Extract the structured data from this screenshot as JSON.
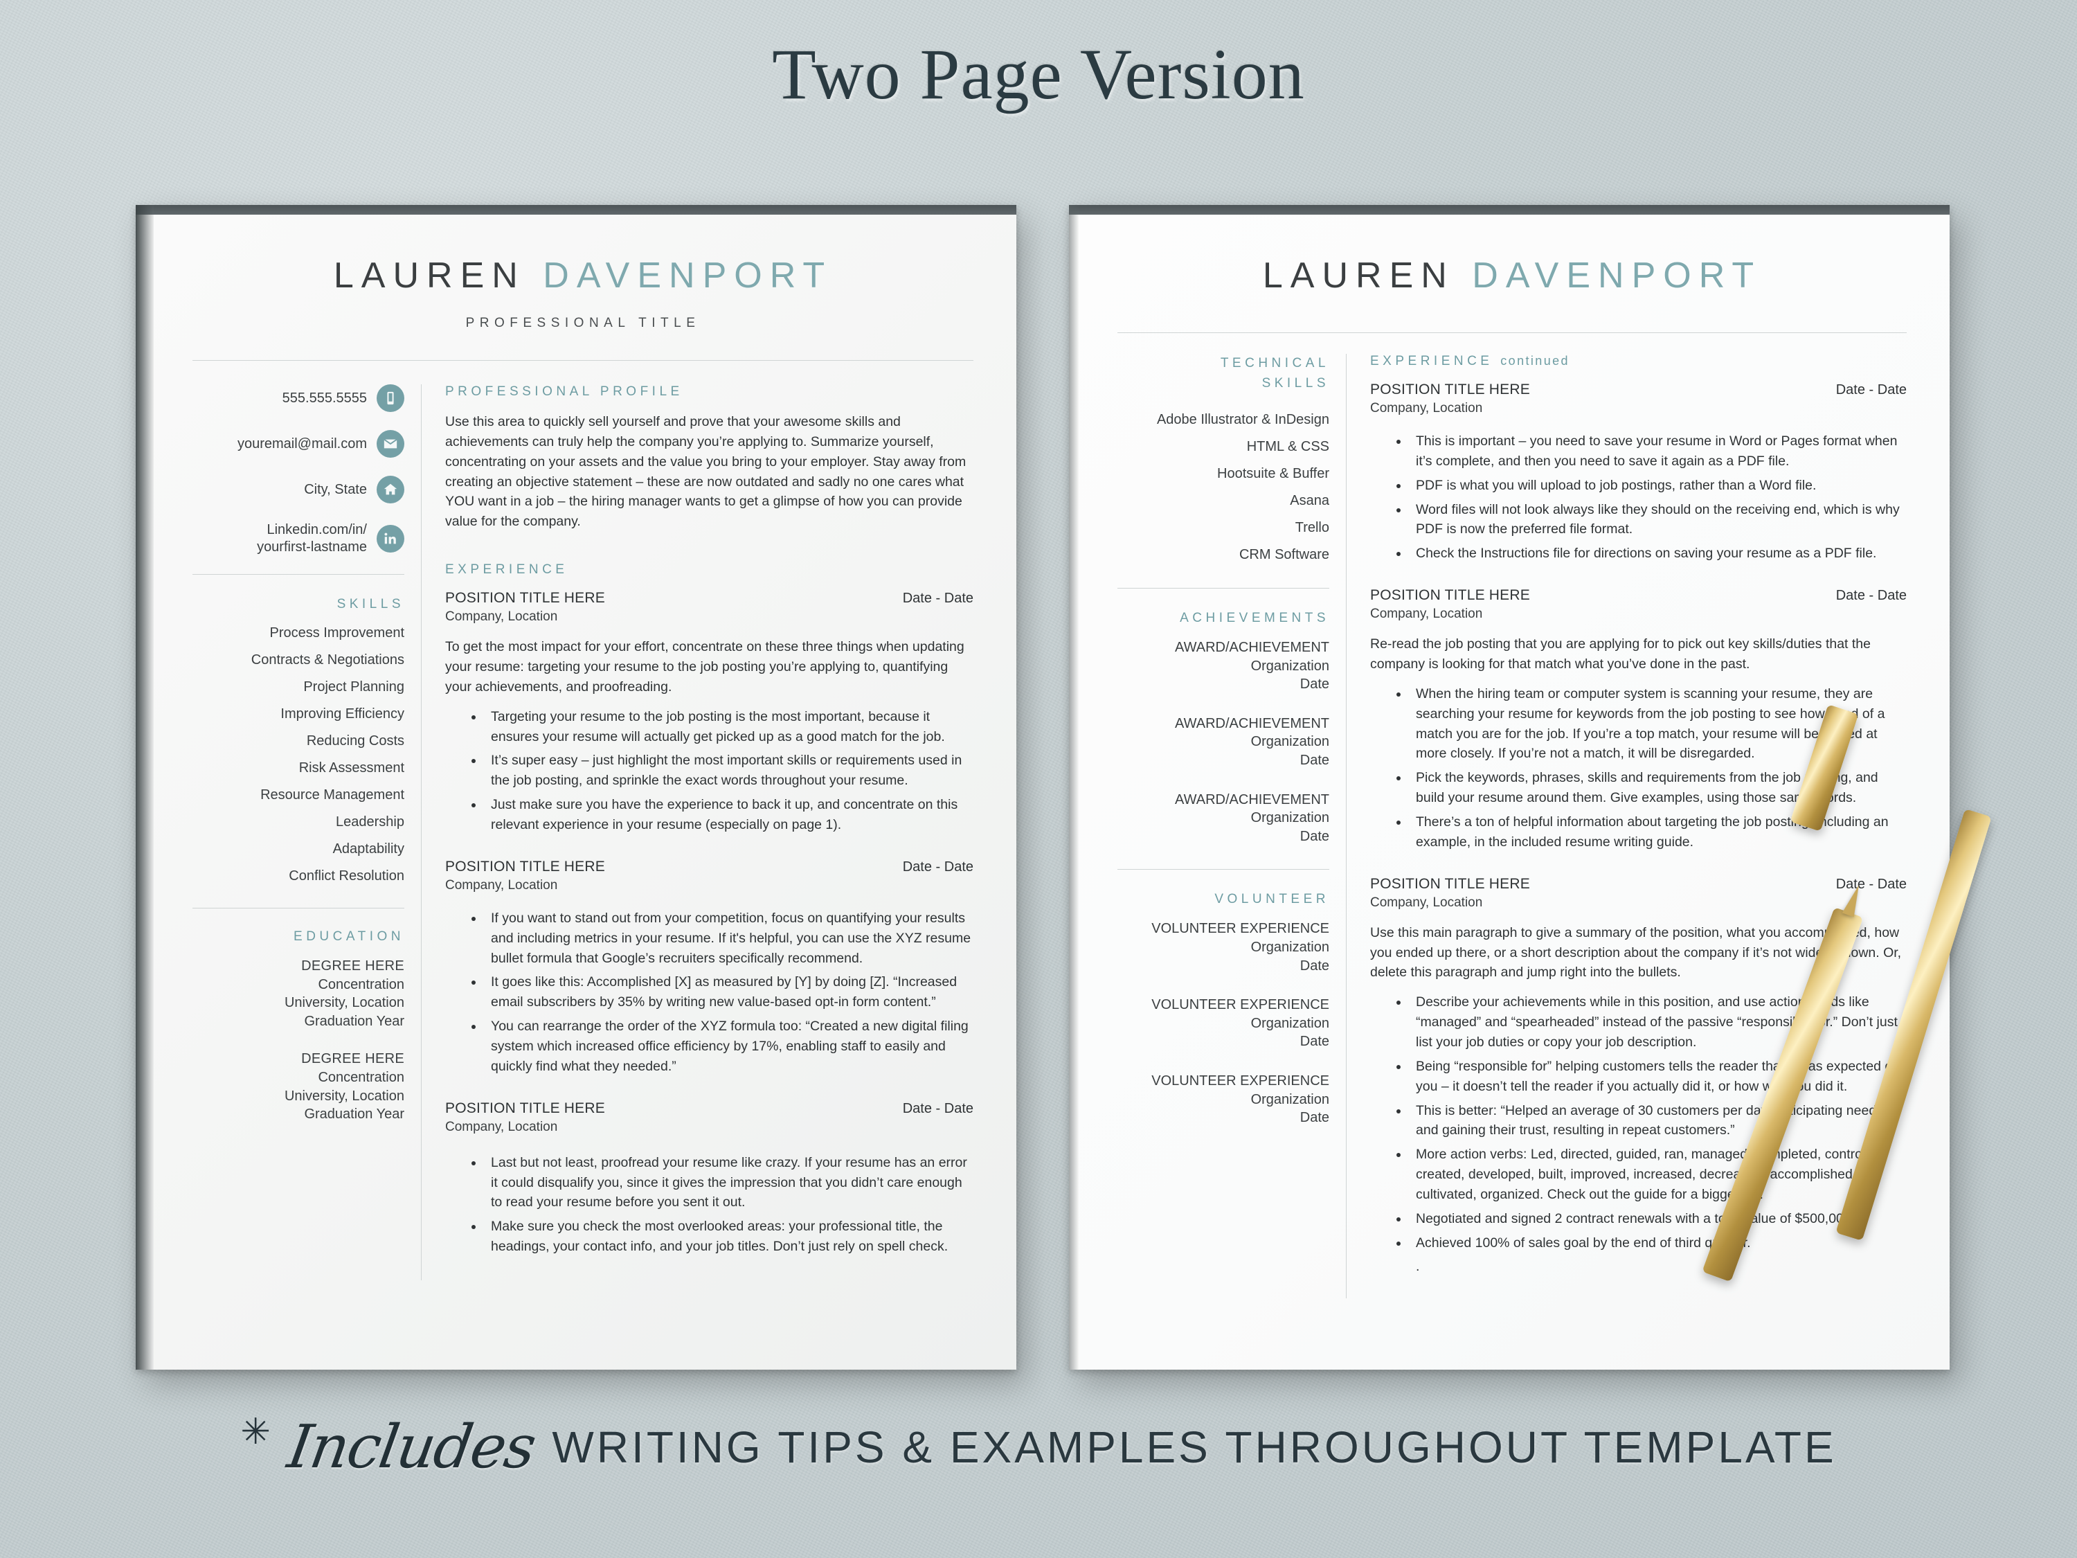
{
  "headline": "Two Page Version",
  "footer": {
    "star": "✳",
    "script_word": "Includes",
    "tagline": "WRITING TIPS & EXAMPLES THROUGHOUT TEMPLATE"
  },
  "colors": {
    "accent_teal": "#6d9ca2",
    "name_last": "#7fa9ae",
    "icon_circle": "#74a0a6",
    "body_text": "#2f3335",
    "background": "#c6d0d2"
  },
  "page1": {
    "name_first": "LAUREN",
    "name_last": "DAVENPORT",
    "professional_title": "PROFESSIONAL TITLE",
    "contact": [
      {
        "icon": "phone-icon",
        "text": "555.555.5555"
      },
      {
        "icon": "envelope-icon",
        "text": "youremail@mail.com"
      },
      {
        "icon": "home-icon",
        "text": "City, State"
      },
      {
        "icon": "linkedin-icon",
        "text": "Linkedin.com/in/\nyourfirst-lastname"
      }
    ],
    "skills_heading": "SKILLS",
    "skills": [
      "Process Improvement",
      "Contracts & Negotiations",
      "Project Planning",
      "Improving Efficiency",
      "Reducing Costs",
      "Risk Assessment",
      "Resource Management",
      "Leadership",
      "Adaptability",
      "Conflict Resolution"
    ],
    "education_heading": "EDUCATION",
    "education": [
      {
        "degree": "DEGREE HERE",
        "concentration": "Concentration",
        "university": "University, Location",
        "year": "Graduation Year"
      },
      {
        "degree": "DEGREE HERE",
        "concentration": "Concentration",
        "university": "University, Location",
        "year": "Graduation Year"
      }
    ],
    "profile_heading": "PROFESSIONAL PROFILE",
    "profile_text": "Use this area to quickly sell yourself and prove that your awesome skills and achievements can truly help the company you’re applying to.  Summarize yourself, concentrating on your assets and the value you bring to your employer. Stay away from creating an objective statement – these are now outdated and sadly no one cares what YOU want in a job – the hiring manager wants to get a glimpse of how you can provide value for the company.",
    "experience_heading": "EXPERIENCE",
    "experience": [
      {
        "title": "POSITION TITLE HERE",
        "date": "Date - Date",
        "company": "Company, Location",
        "paragraph": "To get the most impact for your effort, concentrate on these three things when updating your resume: targeting your resume to the job posting you’re applying to, quantifying your achievements, and proofreading.",
        "bullets": [
          "Targeting your resume to the job posting is the most important, because it ensures your resume will actually get picked up as a good match for the job.",
          "It’s super easy – just highlight the most important skills or requirements used in the job posting, and sprinkle the exact words throughout your resume.",
          "Just make sure you have the experience to back it up, and concentrate on this relevant experience in your resume (especially on page 1)."
        ]
      },
      {
        "title": "POSITION TITLE HERE",
        "date": "Date - Date",
        "company": "Company, Location",
        "paragraph": "",
        "bullets": [
          "If you want to stand out from your competition, focus on quantifying your results and including metrics in your resume. If it's helpful, you can use the XYZ resume bullet formula that Google’s recruiters specifically recommend.",
          "It goes like this: Accomplished [X] as measured by [Y] by doing [Z]. “Increased email subscribers by 35% by writing new value-based opt-in form content.”",
          "You can rearrange the order of the XYZ formula too: “Created a new digital filing system which increased office efficiency by 17%, enabling staff to easily and quickly find what they needed.”"
        ]
      },
      {
        "title": "POSITION TITLE HERE",
        "date": "Date - Date",
        "company": "Company, Location",
        "paragraph": "",
        "bullets": [
          "Last but not least, proofread your resume like crazy. If your resume has an error it could disqualify you, since it gives the impression that you didn’t care enough to read your resume before you sent it out.",
          "Make sure you check the most overlooked areas: your professional title, the headings, your contact info, and your job titles. Don’t just rely on spell check."
        ]
      }
    ]
  },
  "page2": {
    "name_first": "LAUREN",
    "name_last": "DAVENPORT",
    "tech_skills_heading_line1": "TECHNICAL",
    "tech_skills_heading_line2": "SKILLS",
    "tech_skills": [
      "Adobe Illustrator & InDesign",
      "HTML & CSS",
      "Hootsuite & Buffer",
      "Asana",
      "Trello",
      "CRM Software"
    ],
    "achievements_heading": "ACHIEVEMENTS",
    "achievements": [
      {
        "title": "AWARD/ACHIEVEMENT",
        "org": "Organization",
        "date": "Date"
      },
      {
        "title": "AWARD/ACHIEVEMENT",
        "org": "Organization",
        "date": "Date"
      },
      {
        "title": "AWARD/ACHIEVEMENT",
        "org": "Organization",
        "date": "Date"
      }
    ],
    "volunteer_heading": "VOLUNTEER",
    "volunteer": [
      {
        "title": "VOLUNTEER EXPERIENCE",
        "org": "Organization",
        "date": "Date"
      },
      {
        "title": "VOLUNTEER EXPERIENCE",
        "org": "Organization",
        "date": "Date"
      },
      {
        "title": "VOLUNTEER EXPERIENCE",
        "org": "Organization",
        "date": "Date"
      }
    ],
    "experience_heading_main": "EXPERIENCE",
    "experience_heading_cont": "continued",
    "experience": [
      {
        "title": "POSITION TITLE HERE",
        "date": "Date - Date",
        "company": "Company, Location",
        "paragraph": "",
        "bullets": [
          "This is important – you need to save your resume in Word or Pages format when it’s complete, and then you need to save it again as a PDF file.",
          "PDF is what you will upload to job postings, rather than a Word file.",
          "Word files will not look always like they should on the receiving end, which is why PDF is now the preferred file format.",
          "Check the Instructions file for directions on saving your resume as a PDF file."
        ]
      },
      {
        "title": "POSITION TITLE HERE",
        "date": "Date - Date",
        "company": "Company, Location",
        "paragraph": "Re-read the job posting that you are applying for to pick out key skills/duties that the company is looking for that match what you’ve done in the past.",
        "bullets": [
          "When the hiring team or computer system is scanning your resume, they are searching your resume for keywords from the job posting to see how good of a match you are for the job. If you’re a top match, your resume will be looked at more closely. If you’re not a match, it will be disregarded.",
          "Pick the keywords, phrases, skills and requirements from the job posting, and build your resume around them. Give examples, using those same words.",
          "There’s a ton of helpful information about targeting the job posting, including an example, in the included resume writing guide."
        ]
      },
      {
        "title": "POSITION TITLE HERE",
        "date": "Date - Date",
        "company": "Company, Location",
        "paragraph": "Use this main paragraph to give a summary of the position, what you accomplished, how you ended up there, or a short description about the company if it’s not widely known. Or, delete this paragraph and jump right into the bullets.",
        "bullets": [
          "Describe your achievements while in this position, and use action words like “managed” and “spearheaded” instead of the passive “responsible for.”  Don’t just list your job duties or copy your job description.",
          "Being “responsible for” helping customers tells the reader that it was expected of you – it doesn’t tell the reader if you actually did it, or how well you did it.",
          "This is better: “Helped an average of 30 customers per day, anticipating needs and gaining their trust, resulting in repeat customers.”",
          "More action verbs: Led, directed, guided, ran, managed, completed, controlled, created, developed, built, improved, increased, decreased, accomplished, cultivated, organized. Check out the guide for a bigger list.",
          "Negotiated and signed 2 contract renewals with a total value of $500,000.",
          "Achieved 100% of sales goal by the end of third quarter."
        ],
        "trailing_dot": "."
      }
    ]
  }
}
